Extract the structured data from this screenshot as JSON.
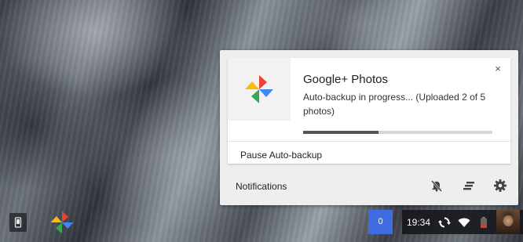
{
  "notification": {
    "title": "Google+ Photos",
    "message": "Auto-backup in progress... (Uploaded 2 of 5 photos)",
    "progress_fraction": 0.4,
    "action_label": "Pause Auto-backup",
    "close_symbol": "×",
    "app_icon": "google-photos-pinwheel-icon"
  },
  "notification_center": {
    "label": "Notifications",
    "buttons": [
      {
        "name": "do-not-disturb",
        "icon": "bell-off-icon"
      },
      {
        "name": "clear-all",
        "icon": "clear-all-icon"
      },
      {
        "name": "settings",
        "icon": "gear-icon"
      }
    ]
  },
  "shelf": {
    "notification_count": "0",
    "time": "19:34",
    "tray_icons": [
      "sync-icon",
      "wifi-icon",
      "battery-icon",
      "avatar"
    ]
  },
  "colors": {
    "accent_blue": "#3f6ce0",
    "progress_fill": "#555555",
    "progress_track": "#d6d6d6"
  }
}
